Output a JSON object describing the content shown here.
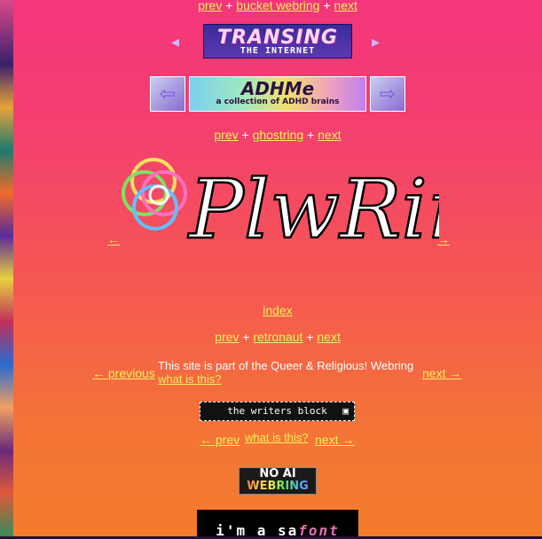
{
  "rings": {
    "bucket": {
      "prev": "prev",
      "name": "bucket webring",
      "next": "next",
      "sep": "+"
    },
    "transing": {
      "line1": "TRANSING",
      "line2": "THE INTERNET",
      "left_arrow": "◂",
      "right_arrow": "▸"
    },
    "adhd": {
      "title": "ADHMe",
      "subtitle": "a collection of ADHD brains"
    },
    "ghostring": {
      "prev": "prev",
      "name": "ghostring",
      "next": "next",
      "sep": "+"
    },
    "plwring": {
      "logo_text": "PlwRing",
      "left": "←",
      "right": "→",
      "index": "index"
    },
    "retronaut": {
      "prev": "prev",
      "name": "retronaut",
      "next": "next",
      "sep": "+"
    },
    "queer": {
      "previous": "← previous",
      "text": "This site is part of the Queer & Religious! Webring",
      "what": "what is this?",
      "next": "next →"
    },
    "writers": {
      "label": "the writers block",
      "icon": "computer-icon",
      "prev": "← prev",
      "what": "what is this?",
      "next": "next →"
    },
    "noai": {
      "line1": "NO AI",
      "line2": "WEBRING"
    },
    "safont": {
      "prefix": "i'm a sa",
      "italic": "font"
    }
  },
  "colors": {
    "link": "#f4f05a",
    "bg_top": "#f4357c",
    "bg_bottom": "#f47c2c"
  }
}
